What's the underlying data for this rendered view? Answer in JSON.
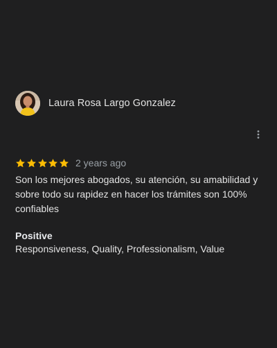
{
  "review": {
    "reviewer_name": "Laura Rosa Largo Gonzalez",
    "avatar_icon": "profile-photo",
    "more_icon": "vertical-ellipsis-icon",
    "rating": 5,
    "max_rating": 5,
    "star_color": "#fbbc04",
    "date": "2 years ago",
    "text": "Son los mejores abogados, su atención, su amabilidad y sobre todo su rapidez en hacer los trámites son 100% confiables",
    "attributes": {
      "title": "Positive",
      "values": "Responsiveness, Quality, Professionalism, Value"
    }
  }
}
